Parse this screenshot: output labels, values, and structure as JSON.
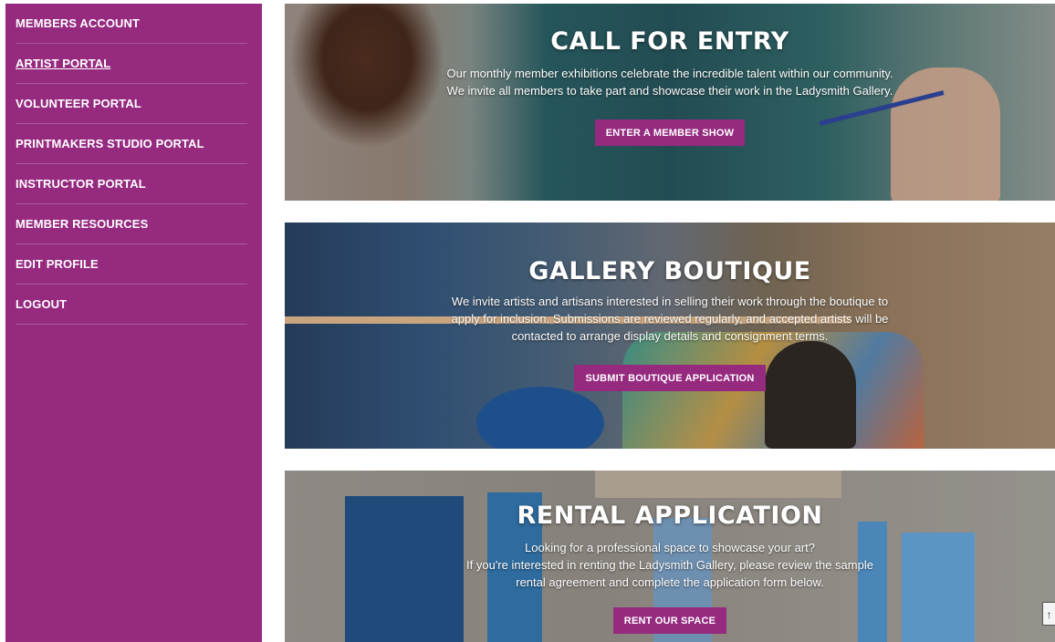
{
  "sidebar": {
    "items": [
      {
        "label": "MEMBERS ACCOUNT"
      },
      {
        "label": "ARTIST PORTAL"
      },
      {
        "label": "VOLUNTEER PORTAL"
      },
      {
        "label": "PRINTMAKERS STUDIO PORTAL"
      },
      {
        "label": "INSTRUCTOR PORTAL"
      },
      {
        "label": "MEMBER RESOURCES"
      },
      {
        "label": "EDIT PROFILE"
      },
      {
        "label": "LOGOUT"
      }
    ],
    "active": "ARTIST PORTAL"
  },
  "panels": {
    "call_for_entry": {
      "title": "CALL FOR ENTRY",
      "text": "Our monthly member exhibitions celebrate the incredible talent within our community. We invite all members to take part and showcase their work in the Ladysmith Gallery.",
      "button": "ENTER A MEMBER SHOW"
    },
    "gallery_boutique": {
      "title": "GALLERY BOUTIQUE",
      "text": "We invite artists and artisans interested in selling their work through the boutique to apply for inclusion. Submissions are reviewed regularly, and accepted artists will be contacted to arrange display details and consignment terms.",
      "button": "SUBMIT BOUTIQUE APPLICATION"
    },
    "rental_application": {
      "title": "RENTAL APPLICATION",
      "text_line1": "Looking for a professional space to showcase your art?",
      "text_line2": "If you're interested in renting the Ladysmith Gallery, please review the sample rental agreement and complete the application form below.",
      "button": "RENT OUR SPACE"
    }
  },
  "scroll_top_icon": "chevron-up-icon",
  "colors": {
    "brand": "#952a7f",
    "text_light": "#ffffff"
  }
}
